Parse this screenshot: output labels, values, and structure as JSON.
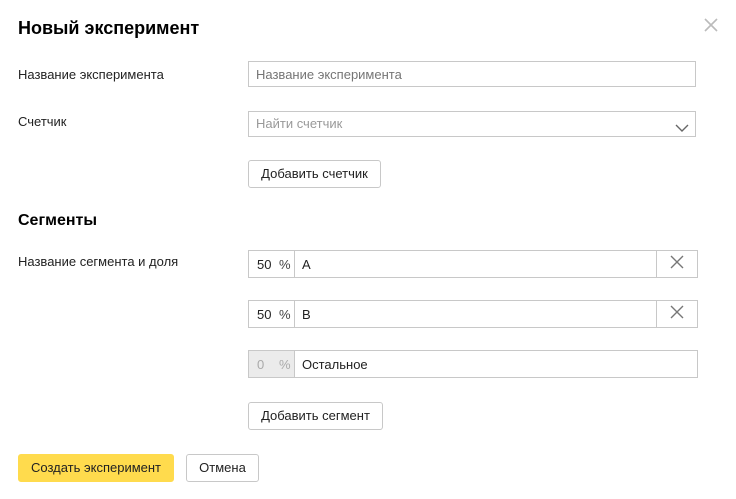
{
  "dialog": {
    "title": "Новый эксперимент"
  },
  "fields": {
    "name_label": "Название эксперимента",
    "name_placeholder": "Название эксперимента",
    "counter_label": "Счетчик",
    "counter_placeholder": "Найти счетчик",
    "add_counter_label": "Добавить счетчик"
  },
  "segments": {
    "section_title": "Сегменты",
    "label": "Название сегмента и доля",
    "percent_symbol": "%",
    "items": [
      {
        "percent": "50",
        "name": "A"
      },
      {
        "percent": "50",
        "name": "B"
      }
    ],
    "rest": {
      "percent": "0",
      "name": "Остальное"
    },
    "add_segment_label": "Добавить сегмент"
  },
  "footer": {
    "create_label": "Создать эксперимент",
    "cancel_label": "Отмена"
  },
  "icons": {
    "close": "close-icon",
    "chevron": "chevron-down-icon",
    "remove": "remove-icon"
  },
  "colors": {
    "primary": "#ffdb4d",
    "border": "#c8c8c8"
  }
}
